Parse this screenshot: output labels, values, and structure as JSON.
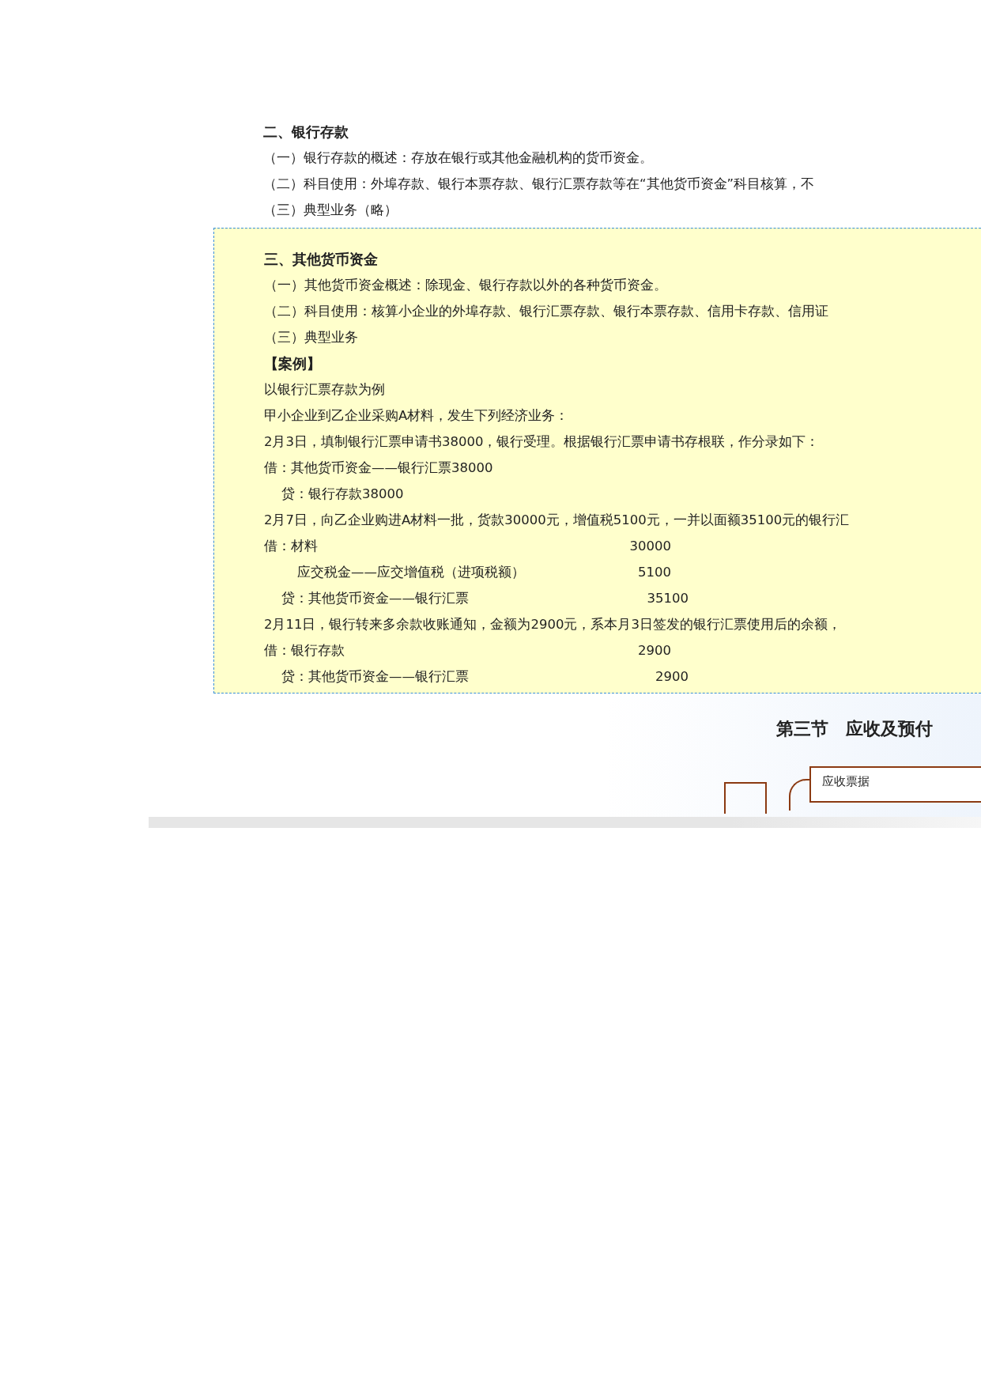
{
  "bank_deposit": {
    "heading": "二、银行存款",
    "lines": [
      "（一）银行存款的概述：存放在银行或其他金融机构的货币资金。",
      "（二）科目使用：外埠存款、银行本票存款、银行汇票存款等在“其他货币资金”科目核算，不",
      "（三）典型业务（略）"
    ]
  },
  "other_funds": {
    "heading": "三、其他货币资金",
    "lines": [
      {
        "kind": "text",
        "text": "（一）其他货币资金概述：除现金、银行存款以外的各种货币资金。"
      },
      {
        "kind": "text",
        "text": "（二）科目使用：核算小企业的外埠存款、银行汇票存款、银行本票存款、信用卡存款、信用证"
      },
      {
        "kind": "text",
        "text": "（三）典型业务"
      },
      {
        "kind": "label",
        "text": "【案例】"
      },
      {
        "kind": "body",
        "text": "以银行汇票存款为例"
      },
      {
        "kind": "body",
        "text": "甲小企业到乙企业采购A材料，发生下列经济业务："
      },
      {
        "kind": "body",
        "text": "2月3日，填制银行汇票申请书38000，银行受理。根据银行汇票申请书存根联，作分录如下："
      },
      {
        "kind": "debit",
        "text": "借：其他货币资金——银行汇票38000"
      },
      {
        "kind": "credit",
        "text": "贷：银行存款38000"
      },
      {
        "kind": "body",
        "text": "2月7日，向乙企业购进A材料一批，货款30000元，增值税5100元，一并以面额35100元的银行汇"
      },
      {
        "kind": "debit",
        "text": "借：材料",
        "amount": "30000"
      },
      {
        "kind": "sub",
        "text": "应交税金——应交增值税（进项税额）",
        "amount": "5100"
      },
      {
        "kind": "credit",
        "text": "贷：其他货币资金——银行汇票",
        "amount": "35100"
      },
      {
        "kind": "body",
        "text": "2月11日，银行转来多余款收账通知，金额为2900元，系本月3日签发的银行汇票使用后的余额，"
      },
      {
        "kind": "debit",
        "text": "借：银行存款",
        "amount": "2900"
      },
      {
        "kind": "credit",
        "text": "贷：其他货币资金——银行汇票",
        "amount": "2900"
      }
    ]
  },
  "slide": {
    "title": "第三节　应收及预付",
    "diagram_item": "应收票据"
  }
}
